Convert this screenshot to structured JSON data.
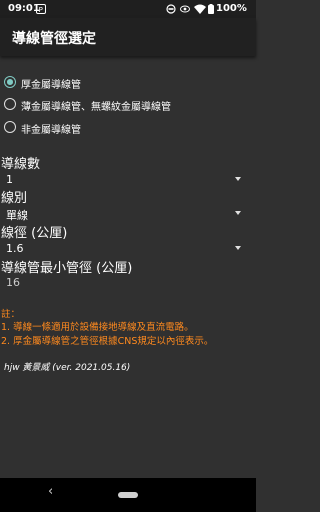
{
  "status": {
    "time": "09:01",
    "battery": "100%",
    "icons": [
      "notification-p-icon",
      "sync-icon",
      "wifi-icon",
      "battery-icon"
    ]
  },
  "appbar": {
    "title": "導線管徑選定"
  },
  "radios": [
    {
      "label": "厚金屬導線管",
      "checked": true
    },
    {
      "label": "薄金屬導線管、無螺紋金屬導線管",
      "checked": false
    },
    {
      "label": "非金屬導線管",
      "checked": false
    }
  ],
  "fields": {
    "count_label": "導線數",
    "count_value": "1",
    "type_label": "線別",
    "type_value": "單線",
    "diameter_label": "線徑 (公厘)",
    "diameter_value": "1.6",
    "result_label": "導線管最小管徑 (公厘)",
    "result_value": "16"
  },
  "notes": {
    "title": "註：",
    "line1": "1. 導線一條適用於設備接地導線及直流電路。",
    "line2": "2. 厚金屬導線管之管徑根據CNS規定以內徑表示。"
  },
  "credit": "hjw  黃景威  (ver. 2021.05.16)",
  "colors": {
    "background": "#303030",
    "appbar": "#212121",
    "accent": "#80cbc4",
    "note": "#ff8a1e"
  }
}
